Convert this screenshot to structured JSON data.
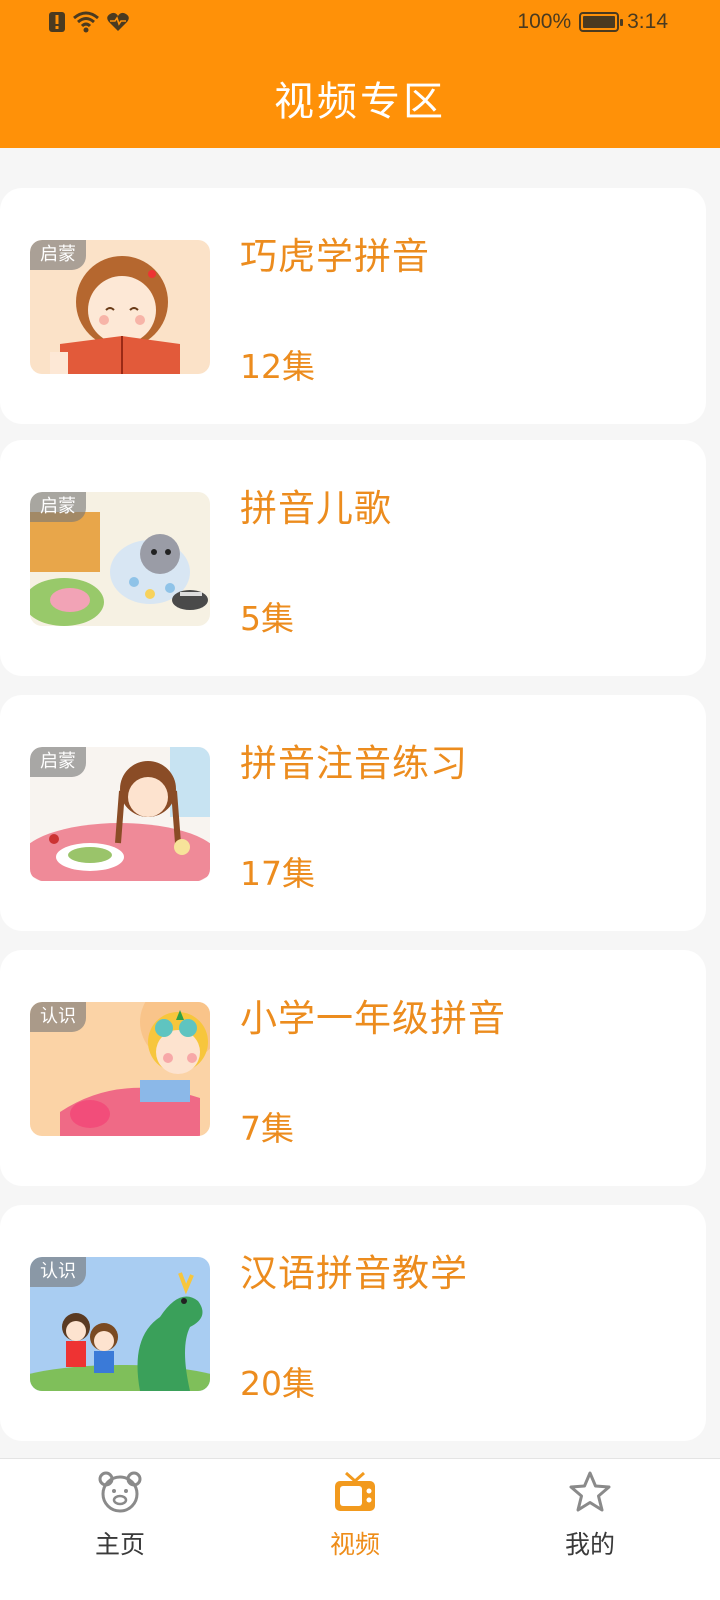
{
  "status_bar": {
    "battery": "100%",
    "time": "3:14"
  },
  "header": {
    "title": "视频专区"
  },
  "videos": [
    {
      "title": "巧虎学拼音",
      "count": "12集",
      "tag": "启蒙"
    },
    {
      "title": "拼音儿歌",
      "count": "5集",
      "tag": "启蒙"
    },
    {
      "title": "拼音注音练习",
      "count": "17集",
      "tag": "启蒙"
    },
    {
      "title": "小学一年级拼音",
      "count": "7集",
      "tag": "认识"
    },
    {
      "title": "汉语拼音教学",
      "count": "20集",
      "tag": "认识"
    }
  ],
  "nav": [
    {
      "label": "主页",
      "icon": "bear-icon"
    },
    {
      "label": "视频",
      "icon": "tv-icon",
      "active": true
    },
    {
      "label": "我的",
      "icon": "star-icon"
    }
  ],
  "colors": {
    "accent": "#ff9108",
    "text_accent": "#ec8c1e"
  }
}
